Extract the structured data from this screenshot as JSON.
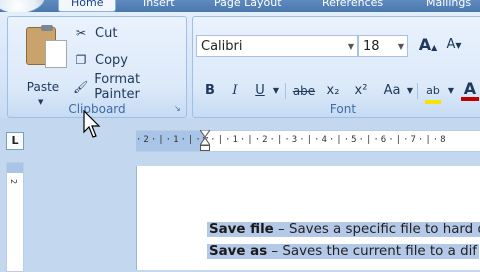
{
  "tabs": [
    {
      "label": "Home",
      "active": true
    },
    {
      "label": "Insert",
      "active": false
    },
    {
      "label": "Page Layout",
      "active": false
    },
    {
      "label": "References",
      "active": false
    },
    {
      "label": "Mailings",
      "active": false
    }
  ],
  "clipboard": {
    "group_label": "Clipboard",
    "paste_label": "Paste",
    "cut_label": "Cut",
    "copy_label": "Copy",
    "format_painter_label": "Format Painter"
  },
  "font": {
    "group_label": "Font",
    "font_name": "Calibri",
    "font_size": "18",
    "bold": "B",
    "italic": "I",
    "underline": "U",
    "strikethrough": "abe",
    "subscript": "x₂",
    "superscript": "x²",
    "change_case": "Aa",
    "grow": "A",
    "shrink": "A"
  },
  "tab_selector": "L",
  "ruler": {
    "marks": "·2·|·1·|·▽·|·1·|·2·|·3·|·4·|·5·|·6·|·7·|·8",
    "vertical_mark": "2"
  },
  "document": {
    "line1_term": "Save file",
    "line1_text": " – Saves a specific file to hard d",
    "line2_term": "Save as",
    "line2_text": " – Saves the current file to a dif"
  },
  "colors": {
    "highlight": "#f5e400",
    "font_color": "#c00000",
    "selection": "#b4c9e8"
  }
}
